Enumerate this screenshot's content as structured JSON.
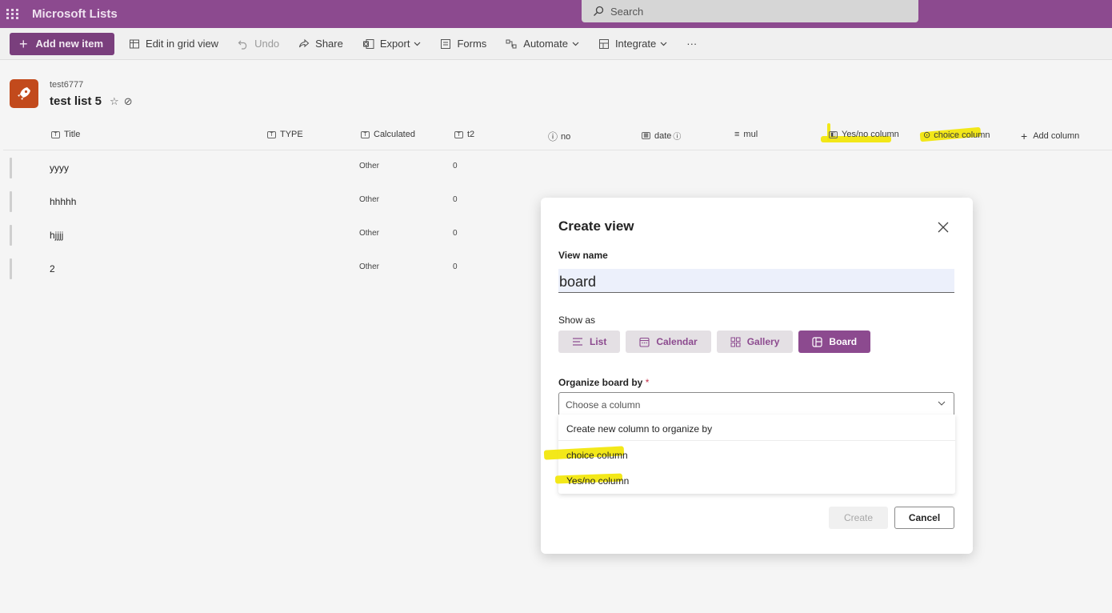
{
  "suite": {
    "app_name": "Microsoft Lists",
    "search_placeholder": "Search",
    "accent": "#8c4a8f"
  },
  "toolbar": {
    "add_new_item": "Add new item",
    "edit_grid": "Edit in grid view",
    "undo": "Undo",
    "share": "Share",
    "export": "Export",
    "forms": "Forms",
    "automate": "Automate",
    "integrate": "Integrate",
    "more": "···"
  },
  "list": {
    "site_name": "test6777",
    "title": "test list 5"
  },
  "columns": {
    "title": "Title",
    "type": "TYPE",
    "calculated": "Calculated",
    "t2": "t2",
    "no": "no",
    "date": "date",
    "mul": "mul",
    "yesno": "Yes/no column",
    "choice": "choice column",
    "add": "Add column"
  },
  "rows": [
    {
      "title": "yyyy",
      "calculated": "Other",
      "t2": "0"
    },
    {
      "title": "hhhhh",
      "calculated": "Other",
      "t2": "0"
    },
    {
      "title": "hjjjj",
      "calculated": "Other",
      "t2": "0"
    },
    {
      "title": "2",
      "calculated": "Other",
      "t2": "0"
    }
  ],
  "dialog": {
    "title": "Create view",
    "view_name_label": "View name",
    "view_name_value": "board",
    "show_as_label": "Show as",
    "show_as_options": [
      "List",
      "Calendar",
      "Gallery",
      "Board"
    ],
    "selected_show_as": "Board",
    "organize_label": "Organize board by",
    "required_marker": "*",
    "select_placeholder": "Choose a column",
    "dropdown_options": [
      "Create new column to organize by",
      "choice column",
      "Yes/no column"
    ],
    "create_button": "Create",
    "cancel_button": "Cancel"
  }
}
